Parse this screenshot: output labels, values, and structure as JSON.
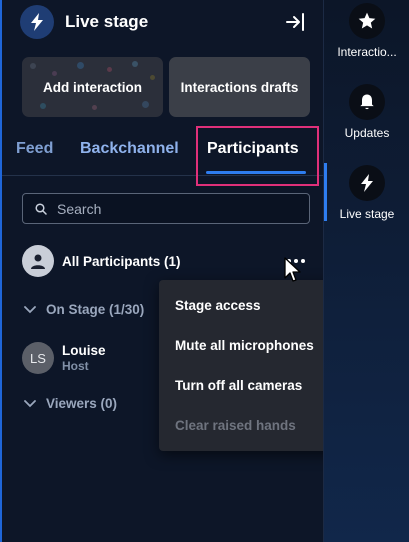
{
  "header": {
    "title": "Live stage"
  },
  "cards": {
    "add_interaction": "Add interaction",
    "interactions_drafts": "Interactions drafts"
  },
  "tabs": [
    {
      "label": "Feed"
    },
    {
      "label": "Backchannel"
    },
    {
      "label": "Participants",
      "active": true
    }
  ],
  "search": {
    "placeholder": "Search",
    "value": ""
  },
  "participants": {
    "all_label": "All Participants (1)",
    "on_stage": {
      "label": "On Stage (1/30)",
      "people": [
        {
          "initials": "LS",
          "name": "Louise",
          "role": "Host"
        }
      ]
    },
    "viewers": {
      "label": "Viewers (0)"
    }
  },
  "menu": {
    "items": [
      {
        "label": "Stage access",
        "has_submenu": true
      },
      {
        "label": "Mute all microphones"
      },
      {
        "label": "Turn off all cameras"
      },
      {
        "label": "Clear raised hands",
        "disabled": true
      }
    ]
  },
  "rail": {
    "items": [
      {
        "label": "Interactio...",
        "icon": "star-icon"
      },
      {
        "label": "Updates",
        "icon": "bell-icon"
      },
      {
        "label": "Live stage",
        "icon": "bolt-icon",
        "active": true
      }
    ]
  },
  "colors": {
    "accent": "#2e7df0",
    "panel_bg": "#0d1628",
    "menu_bg": "#252830",
    "highlight": "#e0307a"
  }
}
